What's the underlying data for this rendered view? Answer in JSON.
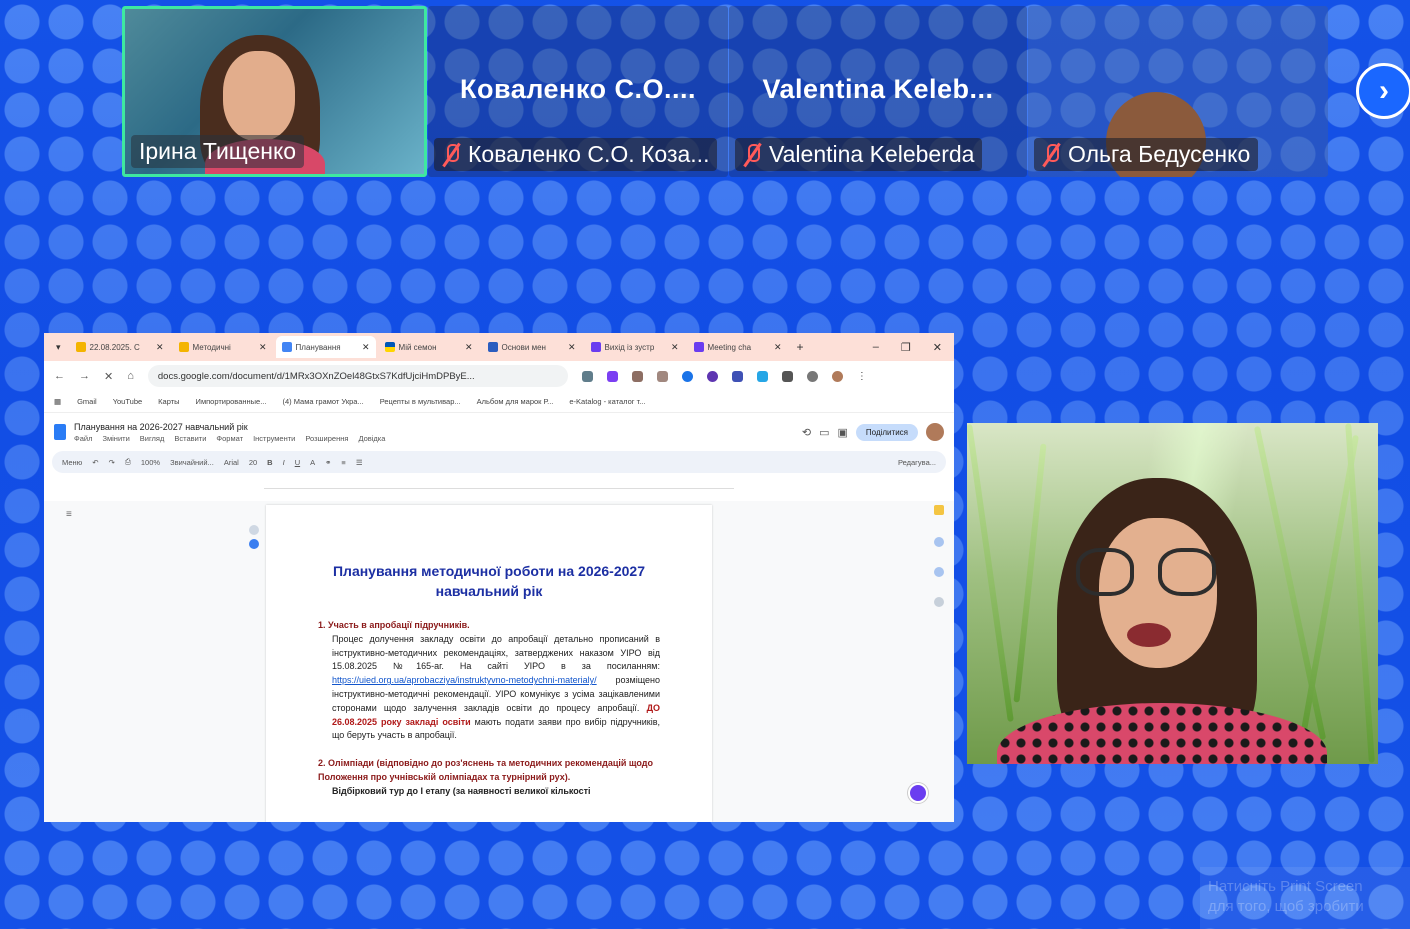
{
  "participants": [
    {
      "name_tag": "Ірина Тищенко",
      "muted": false,
      "active": true,
      "video": true
    },
    {
      "big_name": "Коваленко  С.О....",
      "name_tag": "Коваленко С.О. Коза...",
      "muted": true,
      "active": false,
      "video": false
    },
    {
      "big_name": "Valentina  Keleb...",
      "name_tag": "Valentina Keleberda",
      "muted": true,
      "active": false,
      "video": false
    },
    {
      "name_tag": "Ольга Бедусенко",
      "muted": true,
      "active": false,
      "video": true
    }
  ],
  "next_icon": "chevron-right-icon",
  "browser": {
    "tabs": [
      {
        "label": "22.08.2025. С",
        "icon": "drive-icon",
        "color": "#f4b400"
      },
      {
        "label": "Методичні ",
        "icon": "slides-icon",
        "color": "#f4b400"
      },
      {
        "label": "Планування",
        "icon": "docs-icon",
        "color": "#4285f4",
        "active": true
      },
      {
        "label": "Мій семон",
        "icon": "flag-icon",
        "color": "#ffd500"
      },
      {
        "label": "Основи мен",
        "icon": "site-icon",
        "color": "#2b5dbf"
      },
      {
        "label": "Вихід із зустр",
        "icon": "meet-icon",
        "color": "#6a3df0"
      },
      {
        "label": "Meeting cha",
        "icon": "meet-icon",
        "color": "#6a3df0"
      }
    ],
    "new_tab_label": "+",
    "url": "docs.google.com/document/d/1MRx3OXnZOel48GtxS7KdfUjciHmDPByE...",
    "bookmarks": [
      "Gmail",
      "YouTube",
      "Карты",
      "Импортированные...",
      "(4) Мама грамот Укра...",
      "Рецепты в мультивар...",
      "Альбом для марок Р...",
      "e-Katalog - каталог т..."
    ]
  },
  "docs": {
    "title": "Планування на 2026-2027 навчальний рік",
    "menu": [
      "Файл",
      "Змінити",
      "Вигляд",
      "Вставити",
      "Формат",
      "Інструменти",
      "Розширення",
      "Довідка"
    ],
    "share_label": "Поділитися",
    "toolbar": [
      "Меню",
      "100%",
      "Звичайний...",
      "Arial",
      "20",
      "Редагува..."
    ],
    "heading": "Планування методичної роботи на 2026-2027 навчальний рік",
    "items": [
      {
        "title": "1. Участь в апробації підручників.",
        "text": "Процес долучення закладу освіти до апробації детально прописаний в інструктивно-методичних рекомендаціях, затверджених наказом УІРО від 15.08.2025 №165-аг. На сайті УІРО в за посиланням:",
        "link": "https://uied.org.ua/aprobacziya/instruktyvno-metodychni-materialy/",
        "text2": "розміщено інструктивно-методичні рекомендації. УІРО комунікує з усіма зацікавленими сторонами щодо залучення закладів освіти до процесу апробації.",
        "deadline": "ДО 26.08.2025 року закладі освіти",
        "text3": "мають подати заяви про вибір підручників, що беруть участь в апробації."
      },
      {
        "title": "2. Олімпіади (відповідно до роз'яснень та методичних рекомендацій щодо Положення про учнівській олімпіадах та турнірний рух).",
        "text": "Відбірковий тур до І етапу (за наявності великої кількості"
      }
    ]
  },
  "watermark": {
    "line1": "Натисніть Print Screen",
    "line2": "для того, щоб зробити"
  }
}
